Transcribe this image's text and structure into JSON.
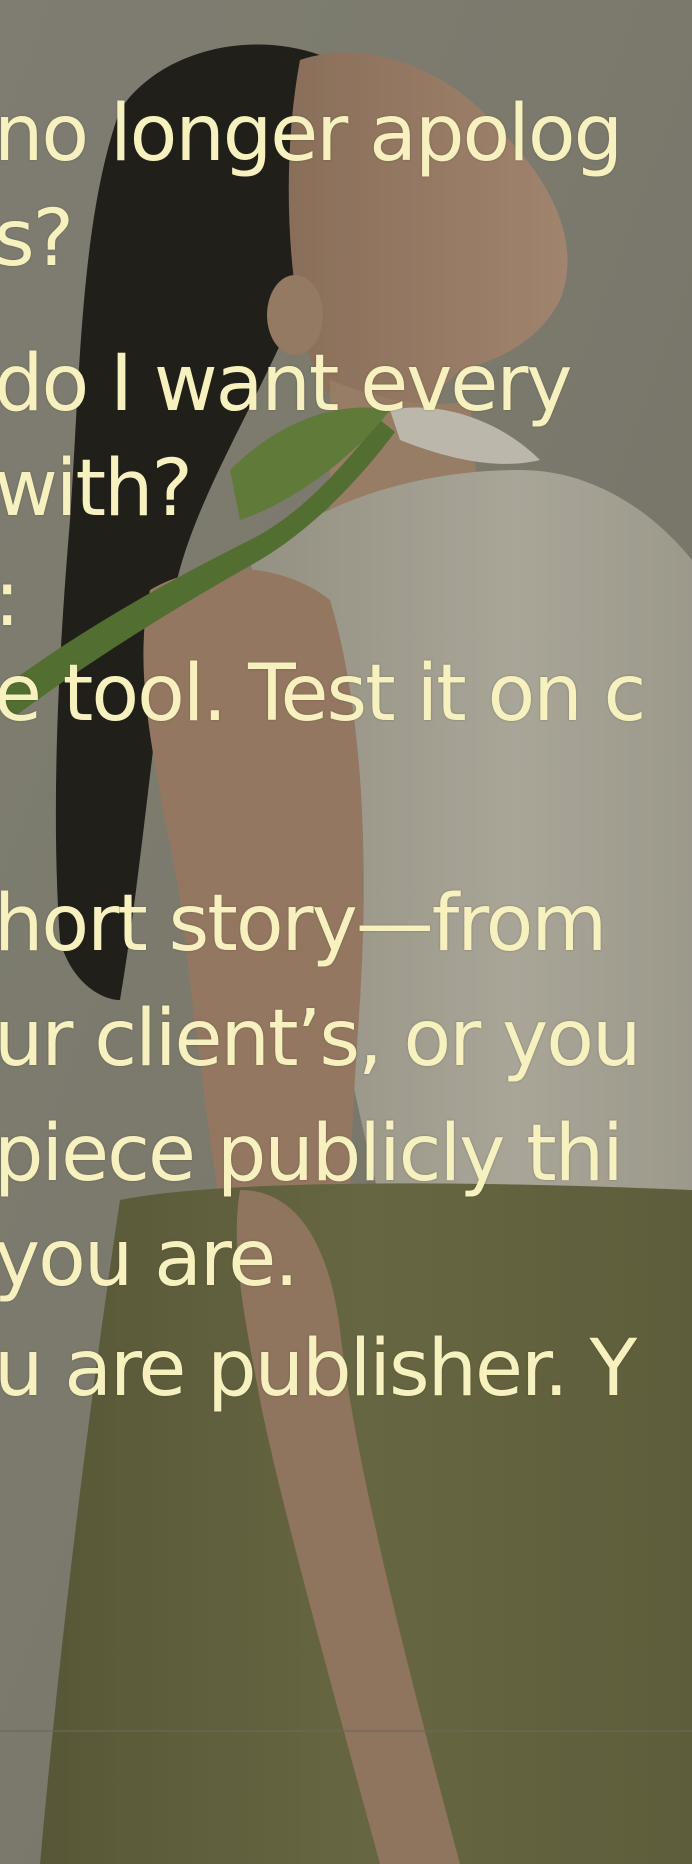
{
  "text_lines": [
    "no longer apolog",
    "s?",
    " do I want every",
    "with?",
    ":",
    "e tool. Test it on c",
    "hort story—from",
    "ur client’s, or you",
    "piece publicly thi",
    " you are.",
    "u are publisher. Y"
  ],
  "colors": {
    "text": "#f6f1bf",
    "background": "#8c8a7c",
    "hair": "#1c1a17",
    "skin": "#b18f77",
    "top": "#bcb8aa",
    "skirt": "#6f6e46",
    "stem": "#5a7a32"
  }
}
